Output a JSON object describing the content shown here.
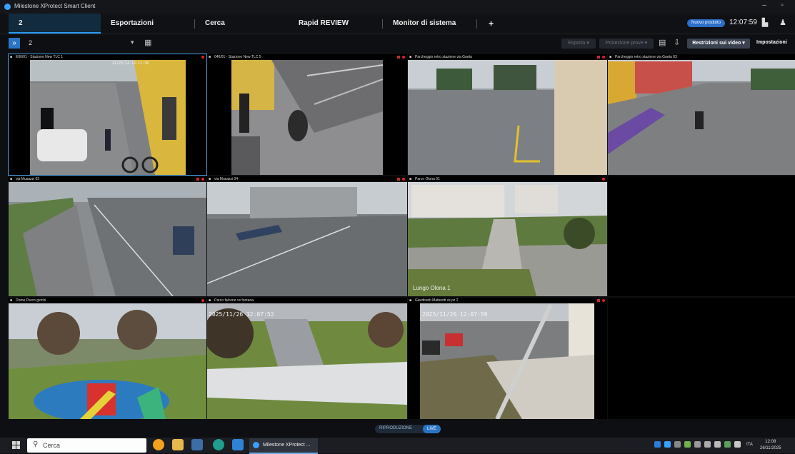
{
  "window": {
    "title": "Milestone XProtect Smart Client"
  },
  "tabs": [
    {
      "label": "2",
      "active": true
    },
    {
      "label": "Esportazioni",
      "active": false
    },
    {
      "label": "Cerca",
      "active": false
    },
    {
      "label": "Rapid REVIEW",
      "active": false
    },
    {
      "label": "Monitor di sistema",
      "active": false
    },
    {
      "label": "+",
      "active": false
    }
  ],
  "header": {
    "new_project": "Nuovo prodotto",
    "clock": "12:07:59"
  },
  "toolbar": {
    "view_number": "2",
    "export_label": "Esporta",
    "protect_label": "Protezione prove",
    "restrict_label": "Restrizioni sui video",
    "settings_label": "Impostazioni"
  },
  "cameras": [
    {
      "name": "E06/01 - Stazione New TLC 1",
      "timestamp": "11/25/14 12:11:38",
      "overlay": ""
    },
    {
      "name": "040/01 - Stazione New TLC 5",
      "timestamp": "",
      "overlay": ""
    },
    {
      "name": "Parcheggio retro stazione via Gaeta",
      "timestamp": "",
      "overlay": ""
    },
    {
      "name": "Parcheggio retro stazione via Gaeta 03",
      "timestamp": "",
      "overlay": ""
    },
    {
      "name": "via Musazzi 03",
      "timestamp": "",
      "overlay": ""
    },
    {
      "name": "via Musazzi 04",
      "timestamp": "",
      "overlay": ""
    },
    {
      "name": "Parco Olona 01",
      "timestamp": "",
      "overlay": "Lungo Olona 1"
    },
    {
      "name": "Dome Parco giochi",
      "timestamp": "",
      "overlay": ""
    },
    {
      "name": "Parco falcone vs fontana",
      "timestamp": "2025/11/26 12:07:52",
      "overlay": ""
    },
    {
      "name": "Giardinetti Matteotti vs pz 2",
      "timestamp": "2025/11/26 12:07:59",
      "overlay": ""
    }
  ],
  "mode": {
    "playback": "RIPRODUZIONE",
    "live": "LIVE"
  },
  "taskbar": {
    "search_placeholder": "Cerca",
    "active_app": "Milestone XProtect ...",
    "lang": "ITA",
    "time": "12:08",
    "date": "26/11/2025"
  },
  "colors": {
    "accent": "#2a74c5",
    "rec": "#e02020",
    "selected_border": "#4a9fe0"
  },
  "icons": [
    "milestone-app-icon",
    "minimize-icon",
    "maximize-icon",
    "save-icon",
    "user-icon",
    "expand-panel-icon",
    "chevron-down-icon",
    "view-layout-icon",
    "bookmark-icon",
    "export-icon",
    "windows-logo-icon",
    "search-icon"
  ]
}
